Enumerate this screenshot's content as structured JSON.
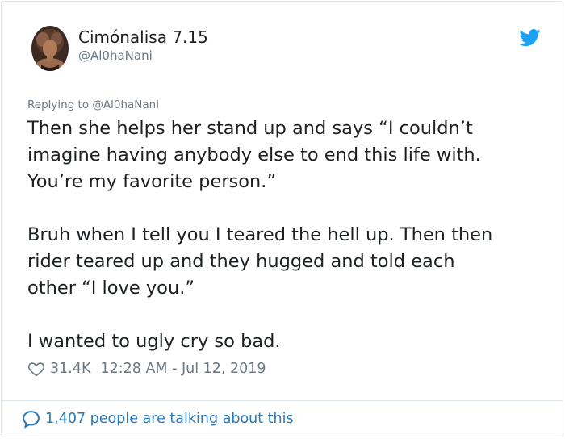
{
  "author": {
    "display_name": "Cimónalisa 7.15",
    "handle": "@Al0haNani",
    "avatar_icon": "profile-photo"
  },
  "header": {
    "logo_icon": "twitter-bird-icon",
    "logo_color": "#1da1f2"
  },
  "tweet": {
    "replying_prefix": "Replying to",
    "replying_to": "@Al0haNani",
    "paragraphs": [
      "Then she helps her stand up and says “I couldn’t\nimagine having anybody else to end this life with.\nYou’re my favorite person.”",
      "Bruh when I tell you I teared the hell up. Then then\nrider teared up and they hugged and told each\nother “I love you.”",
      "I wanted to ugly cry so bad."
    ]
  },
  "meta": {
    "like_icon": "heart-outline-icon",
    "likes": "31.4K",
    "timestamp": "12:28 AM - Jul 12, 2019"
  },
  "footer": {
    "icon": "speech-bubble-icon",
    "talking_text": "1,407 people are talking about this",
    "link_color": "#2b7bb9"
  },
  "colors": {
    "text": "#1c2022",
    "secondary": "#697882",
    "border": "#e1e8ed"
  }
}
